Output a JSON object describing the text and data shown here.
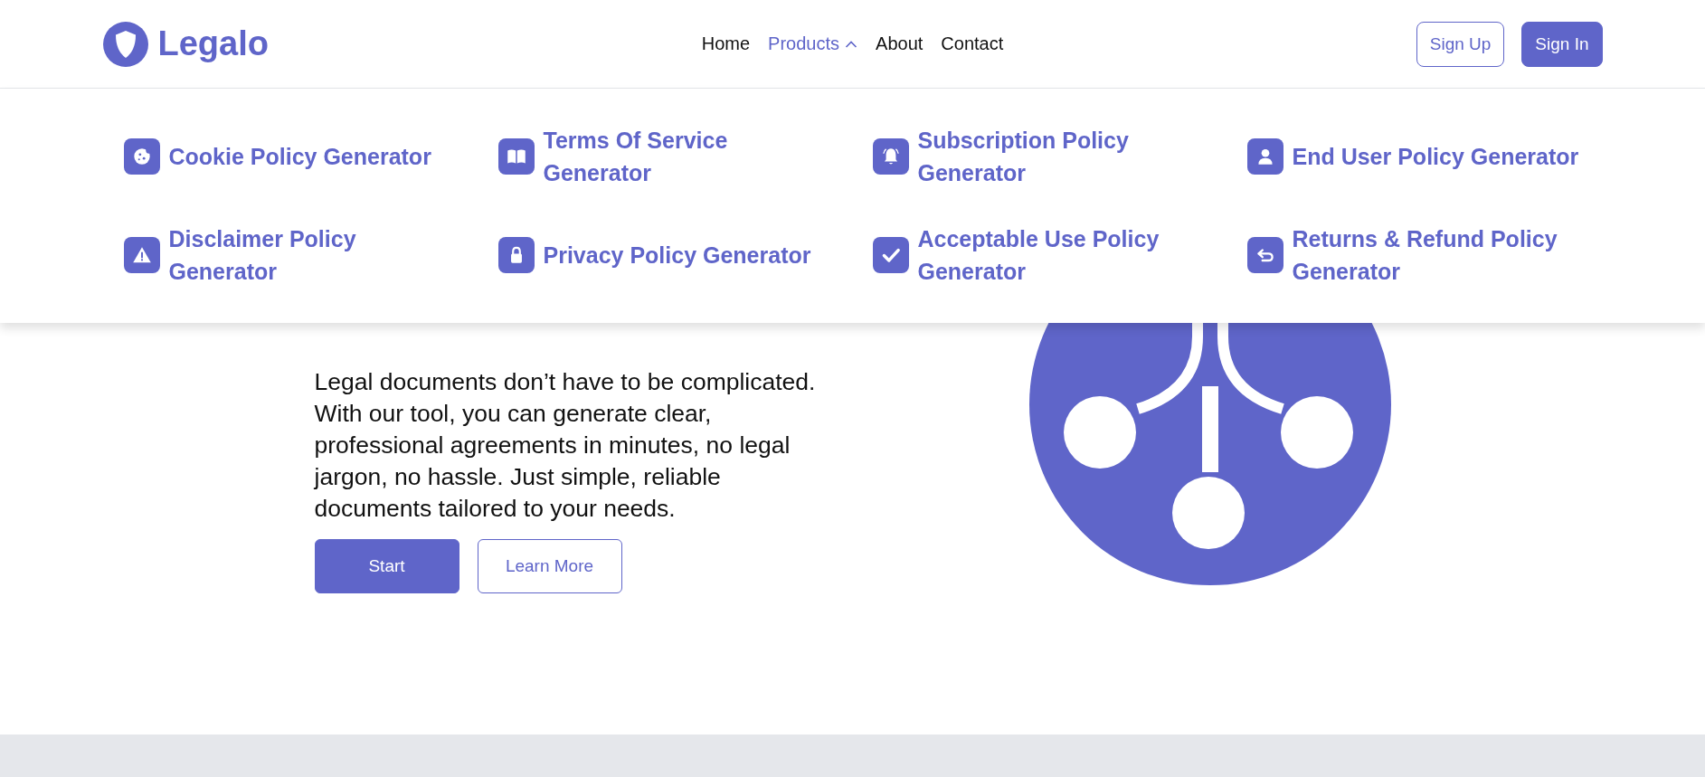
{
  "header": {
    "logo": "Legalo",
    "nav": [
      {
        "label": "Home",
        "kind": "link",
        "selected": false
      },
      {
        "label": "Products",
        "kind": "dropdown",
        "selected": true,
        "expanded": true
      },
      {
        "label": "About",
        "kind": "link",
        "selected": false
      },
      {
        "label": "Contact",
        "kind": "link",
        "selected": false
      }
    ],
    "buttons": [
      {
        "label": "Sign Up",
        "kind": "outline"
      },
      {
        "label": "Sign In",
        "kind": "filled"
      }
    ]
  },
  "products_menu": {
    "items": [
      {
        "label": "Cookie Policy Generator"
      },
      {
        "label": "Terms Of Service Generator"
      },
      {
        "label": "Subscription Policy Generator"
      },
      {
        "label": "End User Policy Generator"
      },
      {
        "label": "Disclaimer Policy Generator"
      },
      {
        "label": "Privacy Policy Generator"
      },
      {
        "label": "Acceptable Use Policy Generator"
      },
      {
        "label": "Returns & Refund Policy Generator"
      }
    ]
  },
  "hero": {
    "text": "Legal documents don’t have to be complicated. With our tool, you can generate clear, professional agreements in minutes, no legal jargon, no hassle. Just simple, reliable documents tailored to your needs.",
    "buttons": [
      {
        "label": "Start",
        "kind": "filled"
      },
      {
        "label": "Learn More",
        "kind": "outline"
      }
    ]
  }
}
